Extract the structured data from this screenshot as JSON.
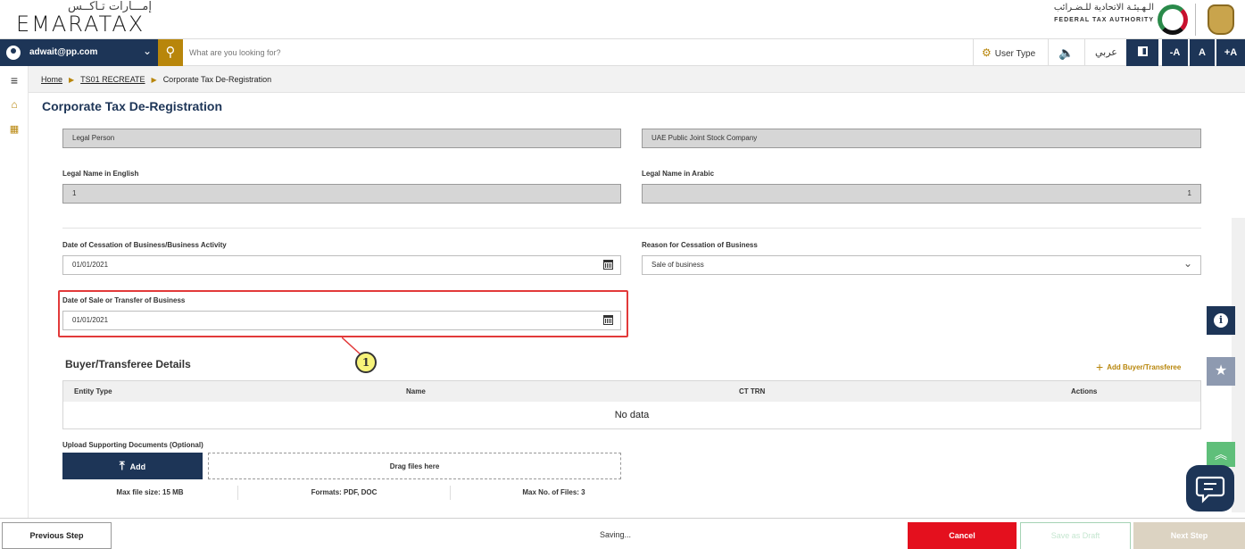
{
  "brand": {
    "logo_arabic": "إمـــارات تـاكــس",
    "logo_english": "EMARATAX",
    "authority_arabic": "الـهـيئـة الاتحادية للـضـرائب",
    "authority_english": "FEDERAL TAX AUTHORITY"
  },
  "toolbar": {
    "user_email": "adwait@pp.com",
    "search_placeholder": "What are you looking for?",
    "user_type_label": "User Type",
    "arabic_label": "عربي",
    "font_decrease": "-A",
    "font_normal": "A",
    "font_increase": "+A",
    "accent_color": "#b8860b",
    "navy_color": "#1d3557"
  },
  "breadcrumb": {
    "home": "Home",
    "parent": "TS01 RECREATE",
    "current": "Corporate Tax De-Registration"
  },
  "page": {
    "title": "Corporate Tax De-Registration"
  },
  "form": {
    "entity_category": "Legal Person",
    "entity_subtype": "UAE Public Joint Stock Company",
    "legal_name_en_label": "Legal Name in English",
    "legal_name_en_value": "1",
    "legal_name_ar_label": "Legal Name in Arabic",
    "legal_name_ar_value": "1",
    "cessation_date_label": "Date of Cessation of Business/Business Activity",
    "cessation_date_value": "01/01/2021",
    "cessation_reason_label": "Reason for Cessation of Business",
    "cessation_reason_value": "Sale of business",
    "sale_date_label": "Date of Sale or Transfer of Business",
    "sale_date_value": "01/01/2021"
  },
  "callout": {
    "number": "1"
  },
  "buyer": {
    "title": "Buyer/Transferee Details",
    "add_label": "Add Buyer/Transferee",
    "columns": [
      "Entity Type",
      "Name",
      "CT TRN",
      "Actions"
    ],
    "empty_text": "No data"
  },
  "upload": {
    "label": "Upload Supporting Documents (Optional)",
    "add_label": "Add",
    "drop_text": "Drag files here",
    "max_size": "Max file size: 15 MB",
    "formats": "Formats: PDF, DOC",
    "max_files": "Max No. of Files: 3"
  },
  "footer": {
    "previous": "Previous Step",
    "status": "Saving...",
    "cancel": "Cancel",
    "save_draft": "Save as Draft",
    "next": "Next Step"
  }
}
